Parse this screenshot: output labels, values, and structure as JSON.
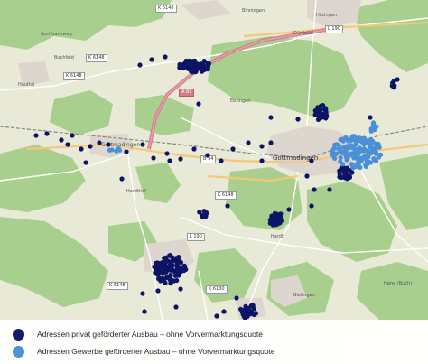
{
  "map": {
    "place_labels": [
      {
        "text": "Suchbachweg",
        "class": "tiny"
      },
      {
        "text": "Buchfeld",
        "class": "tiny"
      },
      {
        "text": "Hauttal",
        "class": "tiny"
      },
      {
        "text": "Gottmadingen",
        "class": "town"
      },
      {
        "text": "Gottmadingen",
        "class": "small"
      },
      {
        "text": "Hardthof",
        "class": "tiny"
      },
      {
        "text": "Hardt",
        "class": "tiny"
      },
      {
        "text": "Binningen",
        "class": "tiny"
      },
      {
        "text": "Randegg",
        "class": "tiny"
      },
      {
        "text": "Dürrbühl",
        "class": "tiny"
      },
      {
        "text": "Hilzingen",
        "class": "tiny"
      },
      {
        "text": "Ebringen",
        "class": "tiny"
      },
      {
        "text": "Hane (Buch)",
        "class": "tiny"
      },
      {
        "text": "Bietingen",
        "class": "tiny"
      }
    ],
    "road_shields": [
      {
        "text": "K 6148",
        "type": "k"
      },
      {
        "text": "K 6148",
        "type": "k"
      },
      {
        "text": "L 190",
        "type": "k"
      },
      {
        "text": "L 190",
        "type": "k"
      },
      {
        "text": "A 81",
        "type": "a"
      },
      {
        "text": "B 34",
        "type": "k"
      },
      {
        "text": "K 6148",
        "type": "k"
      },
      {
        "text": "K 6148",
        "type": "k"
      },
      {
        "text": "K 6130",
        "type": "k"
      },
      {
        "text": "K 6148",
        "type": "k"
      }
    ]
  },
  "colors": {
    "private": "#0c1466",
    "commercial": "#4a90d9",
    "forest": "#a9cf8e",
    "field": "#e8e9d6",
    "urban": "#dcd6cf",
    "motorway": "#d47f8f"
  },
  "legend": {
    "items": [
      {
        "label": "Adressen privat geförderter Ausbau – ohne Vorvermarktungsquote",
        "color": "#0c1466"
      },
      {
        "label": "Adressen Gewerbe geförderter Ausbau – ohne Vorvermarktungsquote",
        "color": "#4a90d9"
      }
    ]
  }
}
